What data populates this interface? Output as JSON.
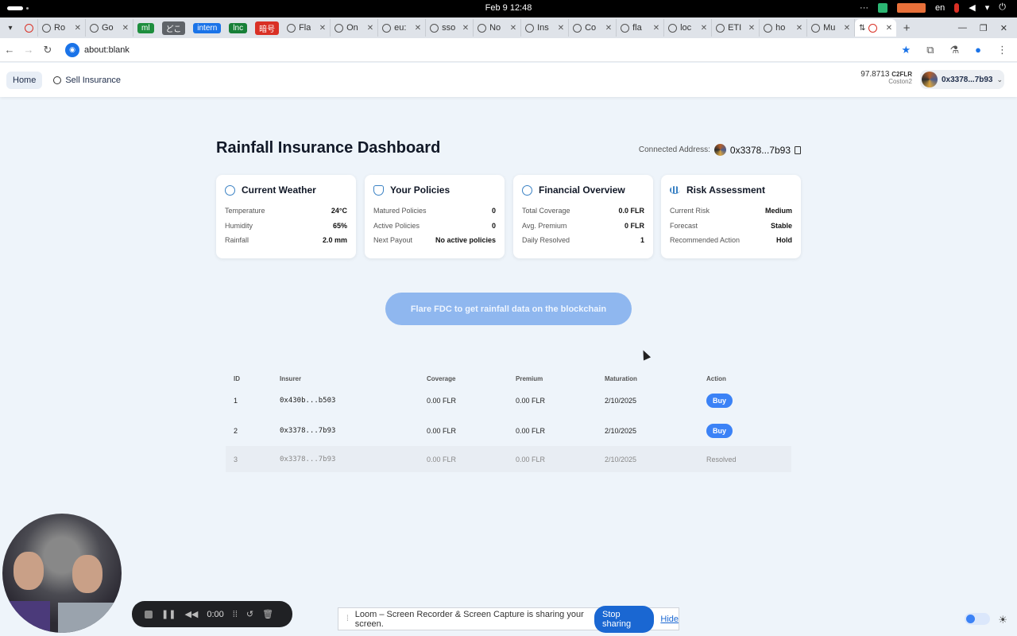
{
  "os": {
    "clock": "Feb 9  12:48",
    "lang": "en"
  },
  "tabs": [
    {
      "label": "Ro",
      "type": "text"
    },
    {
      "label": "Go",
      "type": "text"
    },
    {
      "label": "ml",
      "type": "chip",
      "color": "#1e8e3e"
    },
    {
      "label": "どこ",
      "type": "chip",
      "color": "#5f6368"
    },
    {
      "label": "intern",
      "type": "chip",
      "color": "#1a73e8"
    },
    {
      "label": "lnc",
      "type": "chip",
      "color": "#188038"
    },
    {
      "label": "暗号",
      "type": "chip",
      "color": "#d93025"
    },
    {
      "label": "Fla",
      "type": "text"
    },
    {
      "label": "On",
      "type": "text"
    },
    {
      "label": "eu:",
      "type": "text"
    },
    {
      "label": "sso",
      "type": "text"
    },
    {
      "label": "No",
      "type": "text"
    },
    {
      "label": "Ins",
      "type": "text"
    },
    {
      "label": "Co",
      "type": "text"
    },
    {
      "label": "fla",
      "type": "text"
    },
    {
      "label": "loc",
      "type": "text"
    },
    {
      "label": "ETI",
      "type": "text"
    },
    {
      "label": "ho",
      "type": "text"
    },
    {
      "label": "Mu",
      "type": "text"
    }
  ],
  "address_bar": {
    "url": "about:blank"
  },
  "header": {
    "nav_home": "Home",
    "nav_sell": "Sell Insurance",
    "balance_value": "97.8713",
    "balance_unit": "C2FLR",
    "network": "Coston2",
    "account": "0x3378...7b93"
  },
  "dashboard": {
    "title": "Rainfall Insurance Dashboard",
    "connected_label": "Connected Address:",
    "connected_address": "0x3378...7b93"
  },
  "cards": [
    {
      "title": "Current Weather",
      "icon": "cloud-icon",
      "rows": [
        {
          "k": "Temperature",
          "v": "24°C"
        },
        {
          "k": "Humidity",
          "v": "65%"
        },
        {
          "k": "Rainfall",
          "v": "2.0 mm"
        }
      ]
    },
    {
      "title": "Your Policies",
      "icon": "shield-icon",
      "rows": [
        {
          "k": "Matured Policies",
          "v": "0"
        },
        {
          "k": "Active Policies",
          "v": "0"
        },
        {
          "k": "Next Payout",
          "v": "No active policies"
        }
      ]
    },
    {
      "title": "Financial Overview",
      "icon": "dollar-icon",
      "rows": [
        {
          "k": "Total Coverage",
          "v": "0.0 FLR"
        },
        {
          "k": "Avg. Premium",
          "v": "0 FLR"
        },
        {
          "k": "Daily Resolved",
          "v": "1"
        }
      ]
    },
    {
      "title": "Risk Assessment",
      "icon": "bar-chart-icon",
      "rows": [
        {
          "k": "Current Risk",
          "v": "Medium"
        },
        {
          "k": "Forecast",
          "v": "Stable"
        },
        {
          "k": "Recommended Action",
          "v": "Hold"
        }
      ]
    }
  ],
  "cta": {
    "label": "Flare FDC to get rainfall data on the blockchain"
  },
  "table": {
    "headers": [
      "ID",
      "Insurer",
      "Coverage",
      "Premium",
      "Maturation",
      "Action"
    ],
    "rows": [
      {
        "id": "1",
        "insurer": "0x430b...b503",
        "coverage": "0.00 FLR",
        "premium": "0.00 FLR",
        "maturation": "2/10/2025",
        "action": "Buy"
      },
      {
        "id": "2",
        "insurer": "0x3378...7b93",
        "coverage": "0.00 FLR",
        "premium": "0.00 FLR",
        "maturation": "2/10/2025",
        "action": "Buy"
      },
      {
        "id": "3",
        "insurer": "0x3378...7b93",
        "coverage": "0.00 FLR",
        "premium": "0.00 FLR",
        "maturation": "2/10/2025",
        "action": "Resolved"
      }
    ]
  },
  "recorder": {
    "time": "0:00"
  },
  "share_bar": {
    "message": "Loom – Screen Recorder & Screen Capture is sharing your screen.",
    "stop": "Stop sharing",
    "hide": "Hide"
  }
}
